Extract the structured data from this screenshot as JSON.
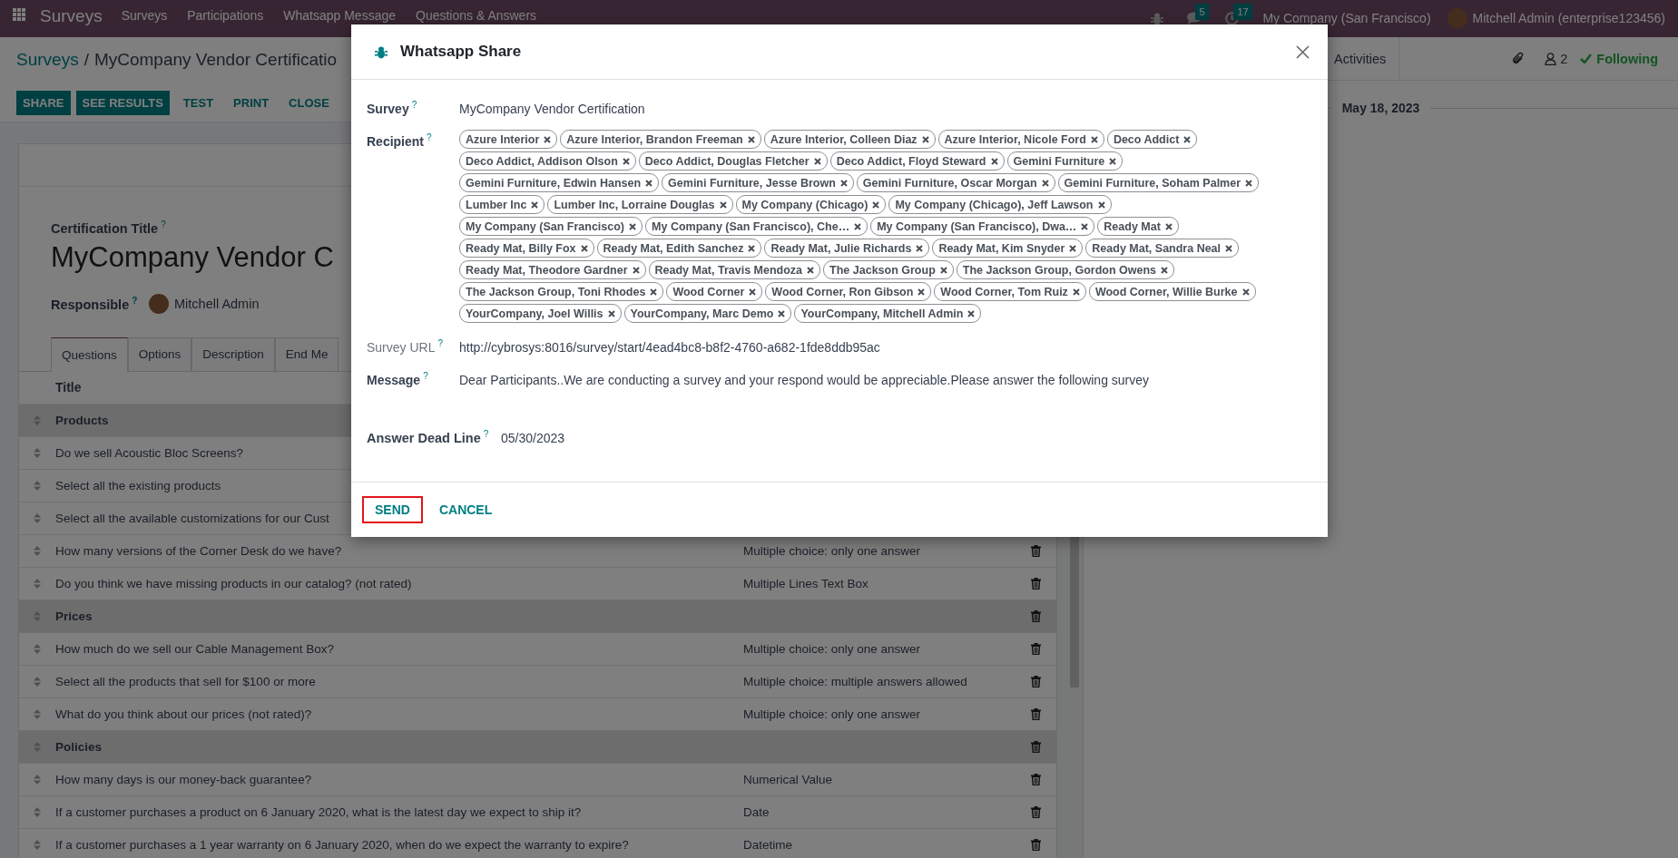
{
  "navbar": {
    "app_name": "Surveys",
    "menus": [
      "Surveys",
      "Participations",
      "Whatsapp Message",
      "Questions & Answers"
    ],
    "chat_count": "5",
    "activity_count": "17",
    "company": "My Company (San Francisco)",
    "user": "Mitchell Admin (enterprise123456)"
  },
  "breadcrumb": {
    "parent": "Surveys",
    "separator": "/",
    "current": "MyCompany Vendor Certificatio"
  },
  "actions": [
    {
      "label": "SHARE",
      "kind": "primary"
    },
    {
      "label": "SEE RESULTS",
      "kind": "primary"
    },
    {
      "label": "TEST",
      "kind": "link"
    },
    {
      "label": "PRINT",
      "kind": "link"
    },
    {
      "label": "CLOSE",
      "kind": "link"
    }
  ],
  "form": {
    "title_label": "Certification Title",
    "title_help": "?",
    "title": "MyCompany Vendor C",
    "responsible_label": "Responsible",
    "responsible_help": "?",
    "responsible": "Mitchell Admin",
    "tabs": [
      {
        "label": "Questions",
        "selected": true
      },
      {
        "label": "Options",
        "selected": false
      },
      {
        "label": "Description",
        "selected": false
      },
      {
        "label": "End Me",
        "selected": false
      }
    ],
    "table": {
      "columns": [
        "Title"
      ],
      "rows": [
        {
          "kind": "section",
          "title": "Products",
          "deletable": false
        },
        {
          "kind": "question",
          "title": "Do we sell Acoustic Bloc Screens?",
          "deletable": false
        },
        {
          "kind": "question",
          "title": "Select all the existing products",
          "deletable": false
        },
        {
          "kind": "question",
          "title": "Select all the available customizations for our Cust",
          "deletable": false
        },
        {
          "kind": "question",
          "title": "How many versions of the Corner Desk do we have?",
          "type": "Multiple choice: only one answer",
          "deletable": true
        },
        {
          "kind": "question",
          "title": "Do you think we have missing products in our catalog? (not rated)",
          "type": "Multiple Lines Text Box",
          "deletable": true
        },
        {
          "kind": "section",
          "title": "Prices",
          "deletable": true
        },
        {
          "kind": "question",
          "title": "How much do we sell our Cable Management Box?",
          "type": "Multiple choice: only one answer",
          "deletable": true
        },
        {
          "kind": "question",
          "title": "Select all the products that sell for $100 or more",
          "type": "Multiple choice: multiple answers allowed",
          "deletable": true
        },
        {
          "kind": "question",
          "title": "What do you think about our prices (not rated)?",
          "type": "Multiple choice: only one answer",
          "deletable": true
        },
        {
          "kind": "section",
          "title": "Policies",
          "deletable": true
        },
        {
          "kind": "question",
          "title": "How many days is our money-back guarantee?",
          "type": "Numerical Value",
          "deletable": true
        },
        {
          "kind": "question",
          "title": "If a customer purchases a product on 6 January 2020, what is the latest day we expect to ship it?",
          "type": "Date",
          "deletable": true
        },
        {
          "kind": "question",
          "title": "If a customer purchases a 1 year warranty on 6 January 2020, when do we expect the warranty to expire?",
          "type": "Datetime",
          "deletable": true
        }
      ]
    }
  },
  "chatter": {
    "activities": "Activities",
    "followers": "2",
    "following": "Following",
    "date": "May 18, 2023"
  },
  "dialog": {
    "title": "Whatsapp Share",
    "fields": [
      {
        "kind": "text",
        "label": "Survey",
        "help": "?",
        "muted": false,
        "value": "MyCompany Vendor Certification"
      },
      {
        "kind": "tags",
        "label": "Recipient",
        "help": "?",
        "muted": false,
        "tags": [
          "Azure Interior",
          "Azure Interior, Brandon Freeman",
          "Azure Interior, Colleen Diaz",
          "Azure Interior, Nicole Ford",
          "Deco Addict",
          "Deco Addict, Addison Olson",
          "Deco Addict, Douglas Fletcher",
          "Deco Addict, Floyd Steward",
          "Gemini Furniture",
          "Gemini Furniture, Edwin Hansen",
          "Gemini Furniture, Jesse Brown",
          "Gemini Furniture, Oscar Morgan",
          "Gemini Furniture, Soham Palmer",
          "Lumber Inc",
          "Lumber Inc, Lorraine Douglas",
          "My Company (Chicago)",
          "My Company (Chicago), Jeff Lawson",
          "My Company (San Francisco)",
          "My Company (San Francisco), Che…",
          "My Company (San Francisco), Dwa…",
          "Ready Mat",
          "Ready Mat, Billy Fox",
          "Ready Mat, Edith Sanchez",
          "Ready Mat, Julie Richards",
          "Ready Mat, Kim Snyder",
          "Ready Mat, Sandra Neal",
          "Ready Mat, Theodore Gardner",
          "Ready Mat, Travis Mendoza",
          "The Jackson Group",
          "The Jackson Group, Gordon Owens",
          "The Jackson Group, Toni Rhodes",
          "Wood Corner",
          "Wood Corner, Ron Gibson",
          "Wood Corner, Tom Ruiz",
          "Wood Corner, Willie Burke",
          "YourCompany, Joel Willis",
          "YourCompany, Marc Demo",
          "YourCompany, Mitchell Admin"
        ]
      },
      {
        "kind": "text",
        "label": "Survey URL",
        "help": "?",
        "muted": true,
        "value": "http://cybrosys:8016/survey/start/4ead4bc8-b8f2-4760-a682-1fde8ddb95ac"
      },
      {
        "kind": "text",
        "label": "Message",
        "help": "?",
        "muted": false,
        "value": "Dear Participants..We are conducting a survey and your respond would be appreciable.Please answer the following survey"
      }
    ],
    "deadline": {
      "label": "Answer Dead Line",
      "help": "?",
      "value": "05/30/2023"
    },
    "buttons": [
      {
        "label": "SEND",
        "kind": "highlighted"
      },
      {
        "label": "CANCEL",
        "kind": "link"
      }
    ]
  }
}
